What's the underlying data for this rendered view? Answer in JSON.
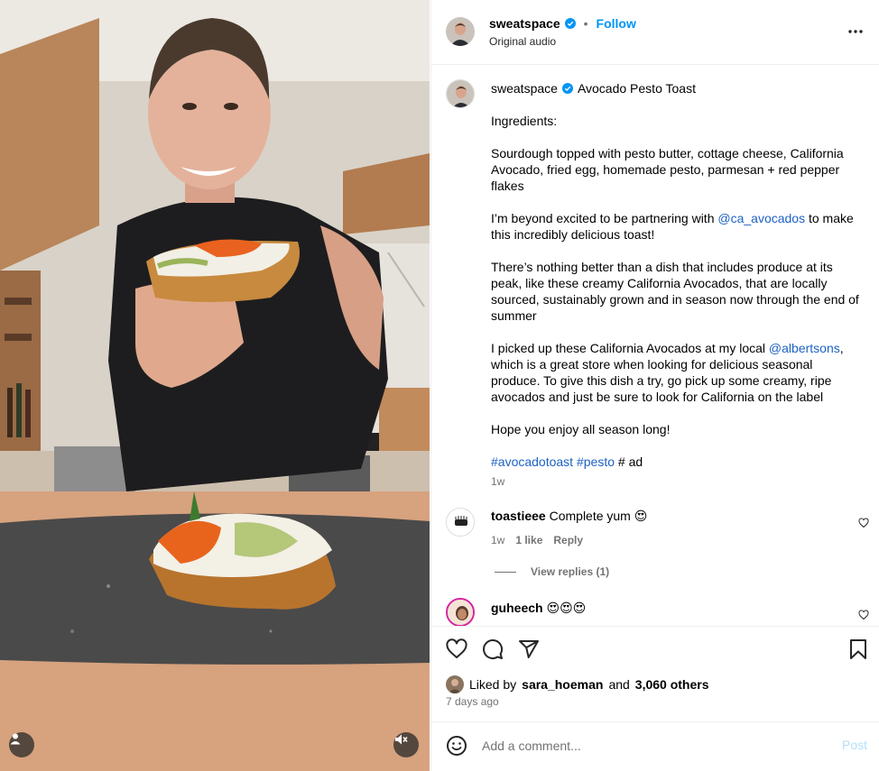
{
  "post": {
    "username": "sweatspace",
    "follow_label": "Follow",
    "separator": "•",
    "audio_label": "Original audio"
  },
  "caption": {
    "username": "sweatspace",
    "title": "Avocado Pesto Toast",
    "ingredients_heading": "Ingredients:",
    "ingredients": "Sourdough topped with pesto butter, cottage cheese, California Avocado, fried egg, homemade pesto, parmesan + red pepper flakes",
    "partner_pre": "I’m beyond excited to be partnering with ",
    "partner_mention": "@ca_avocados",
    "partner_post": " to make this incredibly delicious toast!",
    "paragraph3": "There’s nothing better than a dish that includes produce at its peak, like these creamy California Avocados, that are locally sourced, sustainably grown and in season now through the end of summer",
    "store_pre": "I picked up these California Avocados at my local ",
    "store_mention": "@albertsons",
    "store_post": ", which is a great store when looking for delicious seasonal produce. To give this dish a try, go pick up some creamy, ripe avocados and just be sure to look for California on the label",
    "closing": "Hope you enjoy all season long!",
    "hashtag1": "#avocadotoast",
    "hashtag2": "#pesto",
    "ad_tag": "# ad",
    "time": "1w"
  },
  "comments": [
    {
      "username": "toastieee",
      "text": "Complete yum 😍",
      "time": "1w",
      "likes": "1 like",
      "reply_label": "Reply",
      "view_replies": "View replies (1)"
    },
    {
      "username": "guheech",
      "text": "😍😍😍"
    }
  ],
  "likes": {
    "prefix": "Liked by",
    "liker": "sara_hoeman",
    "conjunction": "and",
    "others": "3,060 others",
    "date": "7 days ago"
  },
  "composer": {
    "placeholder": "Add a comment...",
    "post_label": "Post"
  },
  "colors": {
    "accent": "#0095f6",
    "link": "#1d62c4",
    "muted": "#737373"
  }
}
